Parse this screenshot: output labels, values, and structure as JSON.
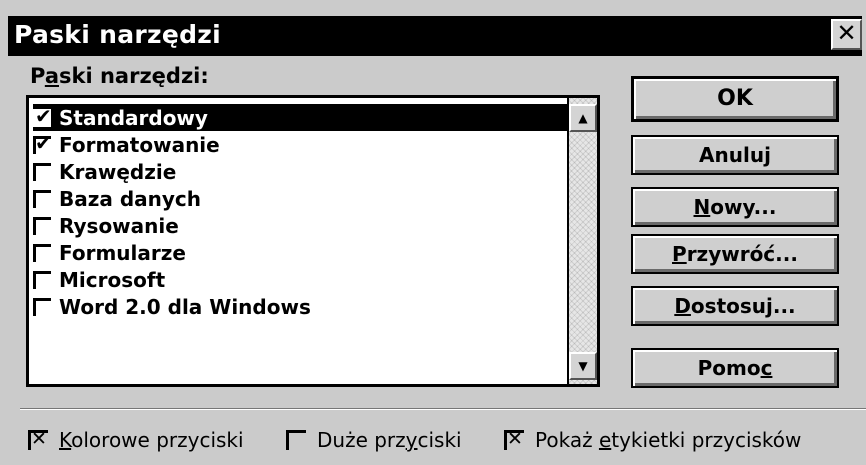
{
  "window": {
    "title": "Paski narzędzi",
    "close_glyph": "✕"
  },
  "list": {
    "label_prefix": "P",
    "label_underlined": "a",
    "label_suffix": "ski narzędzi:",
    "items": [
      {
        "label": "Standardowy",
        "checked": true,
        "selected": true
      },
      {
        "label": "Formatowanie",
        "checked": true,
        "selected": false
      },
      {
        "label": "Krawędzie",
        "checked": false,
        "selected": false
      },
      {
        "label": "Baza danych",
        "checked": false,
        "selected": false
      },
      {
        "label": "Rysowanie",
        "checked": false,
        "selected": false
      },
      {
        "label": "Formularze",
        "checked": false,
        "selected": false
      },
      {
        "label": "Microsoft",
        "checked": false,
        "selected": false
      },
      {
        "label": "Word 2.0 dla Windows",
        "checked": false,
        "selected": false
      }
    ],
    "scroll_up_glyph": "▲",
    "scroll_down_glyph": "▼"
  },
  "buttons": {
    "ok": {
      "label": "OK"
    },
    "cancel": {
      "label": "Anuluj"
    },
    "new": {
      "label_underlined": "N",
      "label_rest": "owy..."
    },
    "reset": {
      "label_underlined": "P",
      "label_rest": "rzywróć..."
    },
    "customize": {
      "label_underlined": "D",
      "label_rest": "ostosuj..."
    },
    "help": {
      "label_prefix": "Pomo",
      "label_underlined": "c"
    }
  },
  "options": {
    "color_buttons": {
      "checked": true,
      "label_underlined": "K",
      "label_rest": "olorowe przyciski"
    },
    "large_buttons": {
      "checked": false,
      "label_prefix": "Duże prz",
      "label_underlined": "y",
      "label_rest": "ciski"
    },
    "show_tooltips": {
      "checked": true,
      "label_prefix": "Pokaż ",
      "label_underlined": "e",
      "label_rest": "tykietki przycisków"
    }
  }
}
